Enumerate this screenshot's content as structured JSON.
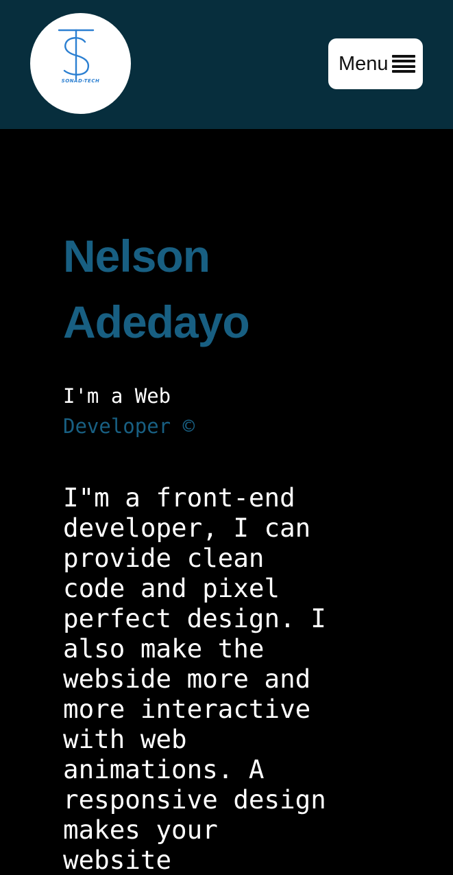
{
  "colors": {
    "header_bg": "#072e3d",
    "page_bg": "#000000",
    "accent": "#185f82",
    "logo_blue": "#2b7fd1"
  },
  "header": {
    "logo": {
      "icon": "ts-monogram-logo",
      "text": "SONAD-TECH"
    },
    "menu_button": {
      "label": "Menu",
      "icon": "hamburger-icon"
    }
  },
  "hero": {
    "name_first": "Nelson",
    "name_last": "Adedayo",
    "role_line1": "I'm a Web",
    "role_line2": "Developer ©",
    "description": "I\"m a front-end developer, I can provide clean code and pixel perfect design. I also make the webside more and more interactive with web animations. A responsive design makes your website"
  }
}
